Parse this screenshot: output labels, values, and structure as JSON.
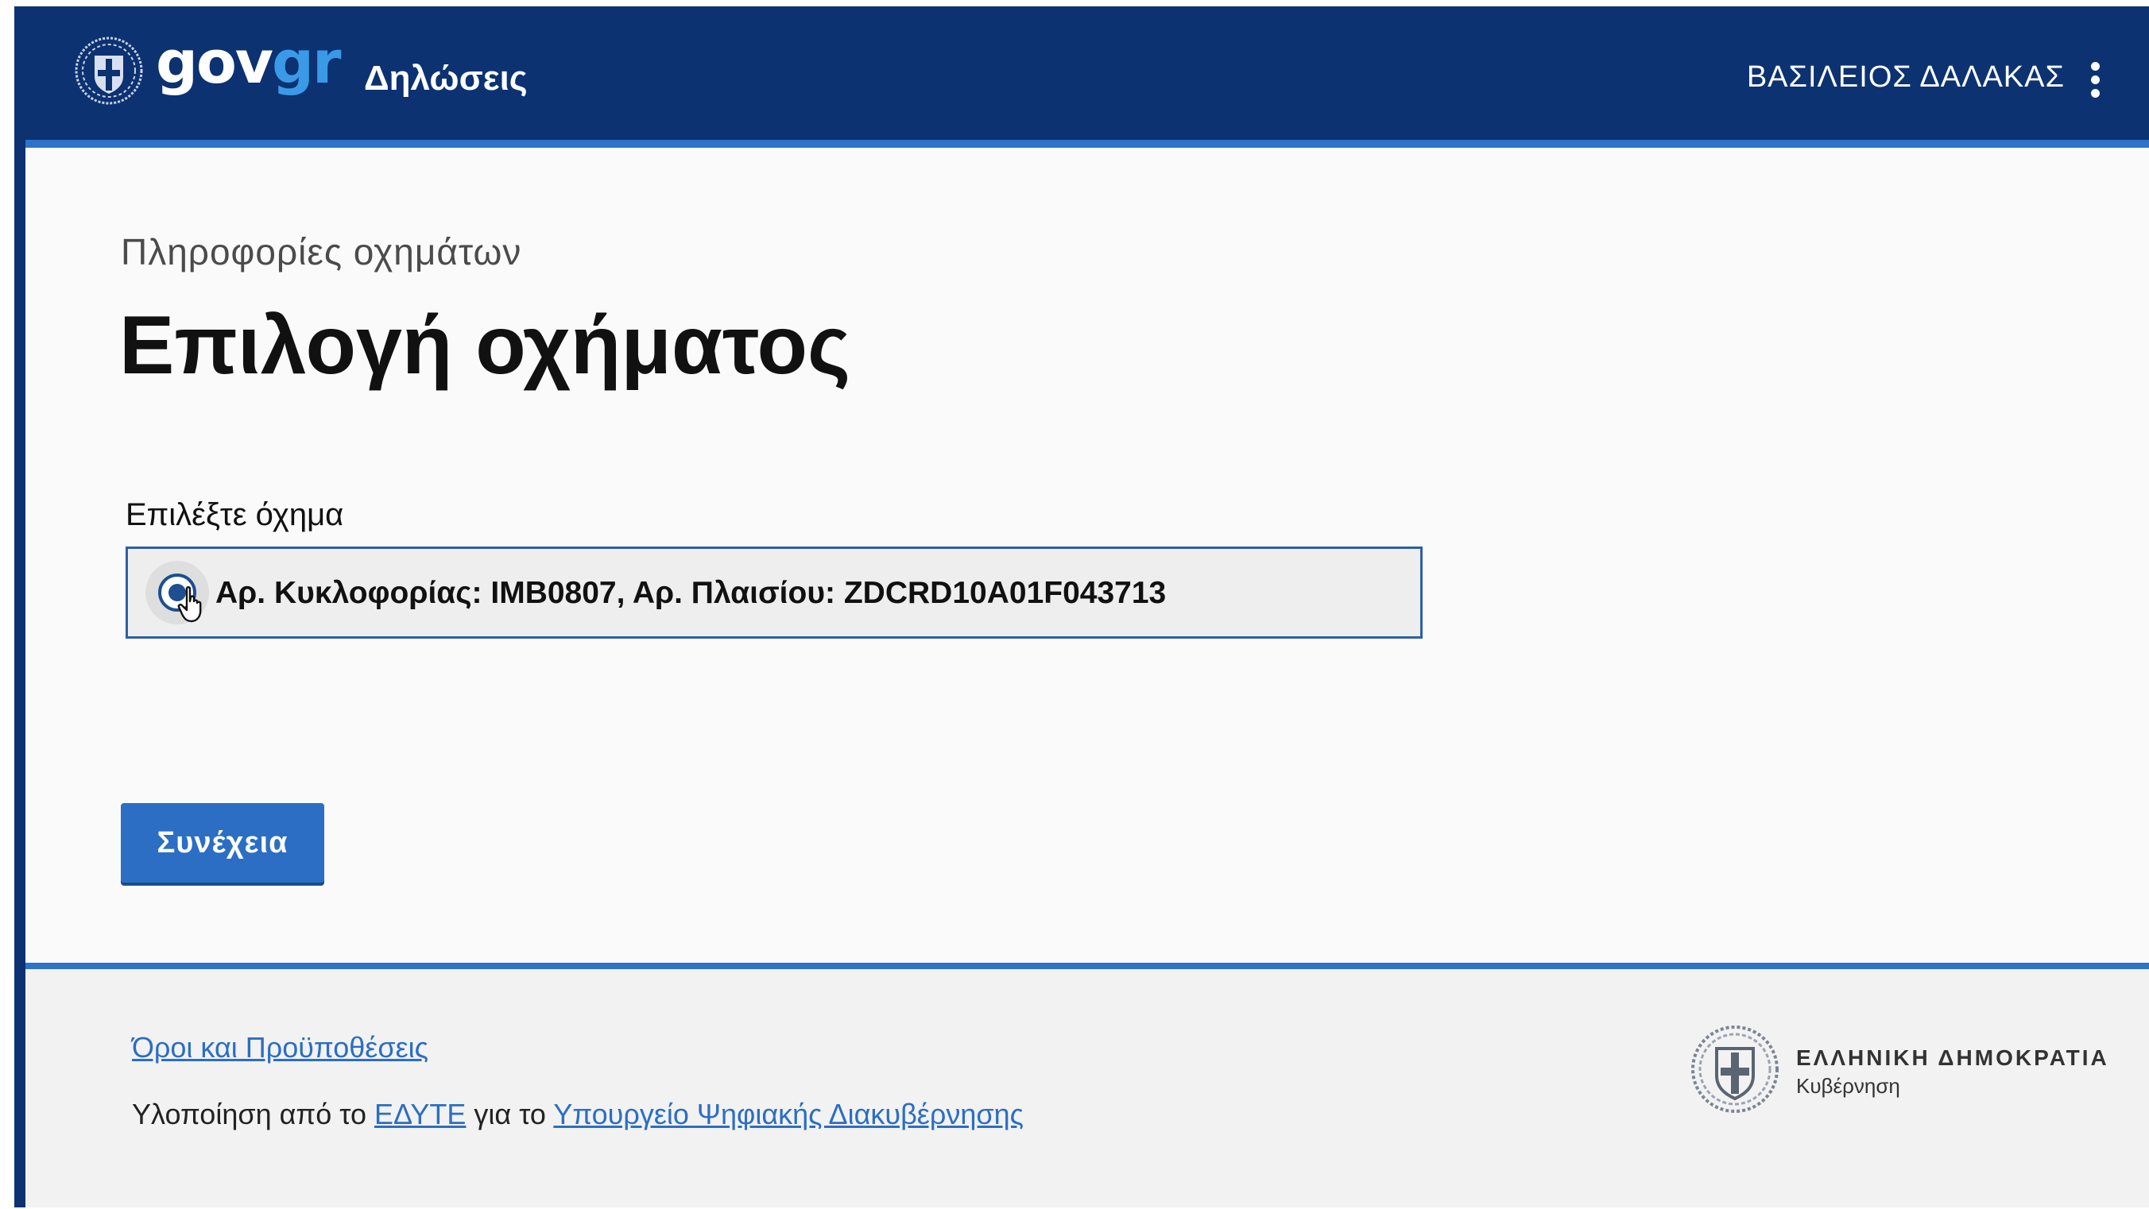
{
  "header": {
    "logo_main": "gov",
    "logo_accent": "gr",
    "app_title": "Δηλώσεις",
    "user_name": "ΒΑΣΙΛΕΙΟΣ ΔΑΛΑΚΑΣ",
    "colors": {
      "background": "#0c3272",
      "accent": "#2e72c9",
      "logo_accent": "#3a9ae8"
    }
  },
  "main": {
    "caption": "Πληροφορίες οχημάτων",
    "title": "Επιλογή οχήματος",
    "field_label": "Επιλέξτε όχημα",
    "options": [
      {
        "label": "Αρ. Κυκλοφορίας: ΙΜΒ0807, Αρ. Πλαισίου: ZDCRD10A01F043713",
        "selected": true
      }
    ],
    "continue_label": "Συνέχεια"
  },
  "footer": {
    "terms_link": "Όροι και Προϋποθέσεις",
    "impl_prefix": "Υλοποίηση από το ",
    "impl_org": "ΕΔΥΤΕ",
    "impl_middle": " για το ",
    "impl_ministry": "Υπουργείο Ψηφιακής Διακυβέρνησης",
    "gov_name": "ΕΛΛΗΝΙΚΗ ΔΗΜΟΚΡΑΤΙΑ",
    "gov_sub": "Κυβέρνηση"
  },
  "icons": {
    "header_emblem": "greek-coat-of-arms-icon",
    "menu": "more-vertical-icon",
    "pointer": "hand-pointer-cursor-icon",
    "footer_emblem": "greek-coat-of-arms-icon"
  }
}
